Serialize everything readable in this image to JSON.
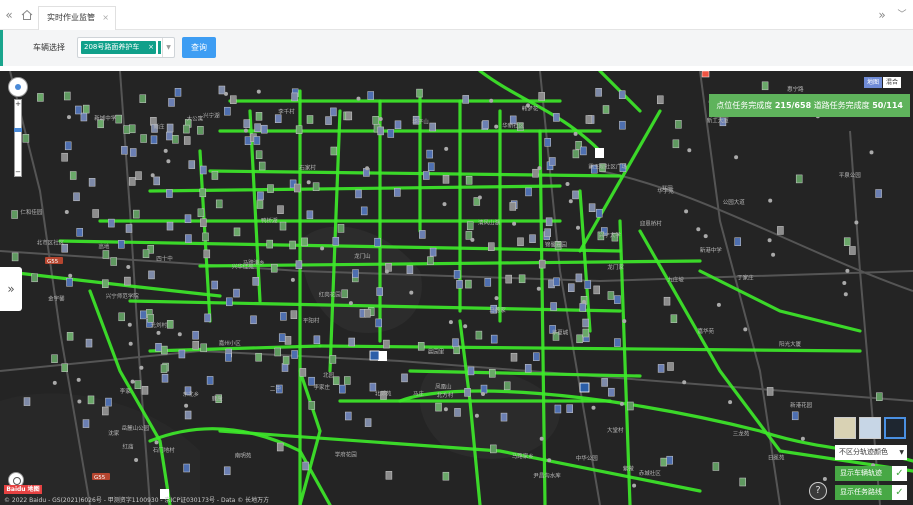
{
  "tabbar": {
    "prev_icon": "double-chevron-left",
    "home_icon": "home",
    "tab_label": "实时作业监管",
    "next_icon": "double-chevron-right",
    "menu_icon": "chevron-down"
  },
  "filter": {
    "vehicle_label": "车辆选择",
    "selected_vehicle": "208号路面养护车",
    "query_button": "查询"
  },
  "map": {
    "type_options": [
      "地图",
      "混合"
    ],
    "active_type": "地图",
    "progress_point_label": "点位任务完成度",
    "progress_point_value": "215/658",
    "progress_road_label": "道路任务完成度",
    "progress_road_value": "50/114",
    "color_select_value": "不区分轨迹颜色",
    "toggle_track": "显示车辆轨迹",
    "toggle_route": "显示任务路线",
    "logo_text": "Baidu 地图",
    "copyright": "© 2022 Baidu - GS(2021)6026号 - 甲测资字1100930 - 京ICP证030173号 - Data © 长地万方",
    "labels": [
      "迎恩桥村",
      "锦馨嘉园",
      "兆田",
      "李家",
      "清风山湖",
      "紫微",
      "华平山",
      "日冕苑",
      "鹿崖",
      "光刘村",
      "金宇馨",
      "韩梦花",
      "晨园里",
      "兴华佳苑",
      "大公寓",
      "嘉华苑",
      "方平中华",
      "石家村",
      "马庄",
      "平阳村",
      "李家庄",
      "九庄坡",
      "丁家庄",
      "华新社区",
      "新城中学",
      "星原小区",
      "红岗花园",
      "大堂村",
      "马德家",
      "北市区社区",
      "平泉公园",
      "龙门山",
      "东湖苑",
      "马蹄港乡",
      "中华公园",
      "二中",
      "三龙苑",
      "龙门家",
      "马路家乡",
      "岳麓山公园",
      "公园大道",
      "沈家",
      "北园",
      "北郊苑",
      "石门地村",
      "新港花园",
      "华宇苑",
      "高地",
      "四十中",
      "兴宁湖",
      "嘉州小区",
      "学府花园",
      "兴宁师范学院",
      "惠宁路",
      "阳光大厦",
      "赤城社区",
      "北方村",
      "红庙",
      "凤凰山",
      "鸭桥湖",
      "李千村",
      "霸王坝社区广场",
      "尹昌沟水库",
      "新港中学",
      "华夏城",
      "新工大厦",
      "仁和佳园",
      "兴宁大学",
      "南明苑",
      "新庄",
      "东北乡"
    ],
    "road_badges": [
      "G55",
      "G55"
    ]
  }
}
